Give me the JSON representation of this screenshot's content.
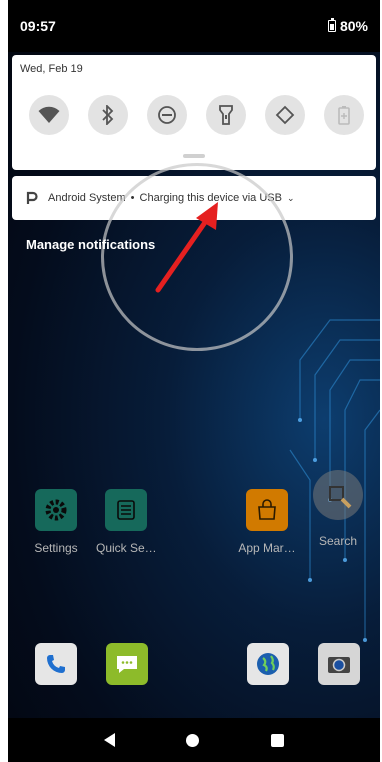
{
  "status_bar": {
    "time": "09:57",
    "battery": "80%"
  },
  "quick_settings": {
    "date": "Wed, Feb 19",
    "tiles": [
      {
        "name": "wifi"
      },
      {
        "name": "bluetooth"
      },
      {
        "name": "do-not-disturb"
      },
      {
        "name": "flashlight"
      },
      {
        "name": "auto-rotate"
      },
      {
        "name": "battery-saver"
      }
    ]
  },
  "notification": {
    "app": "Android System",
    "separator": "•",
    "text": "Charging this device via USB",
    "chevron": "⌄"
  },
  "manage_label": "Manage notifications",
  "apps": [
    {
      "label": "Settings",
      "icon": "settings-gear",
      "color": "#16695b"
    },
    {
      "label": "Quick Se…",
      "icon": "quick-settings-sliders",
      "color": "#16695b"
    },
    {
      "label": "App Mar…",
      "icon": "shopping-bag",
      "color": "#d17a00"
    },
    {
      "label": "Search",
      "icon": "magnifier",
      "color": "#8a8a8a"
    }
  ],
  "dock": [
    {
      "icon": "phone",
      "color": "#e6e6e6"
    },
    {
      "icon": "messages",
      "color": "#8dbb2a"
    },
    {
      "icon": "browser-globe",
      "color": "#e6e6e6"
    },
    {
      "icon": "camera",
      "color": "#d6d6d6"
    }
  ]
}
